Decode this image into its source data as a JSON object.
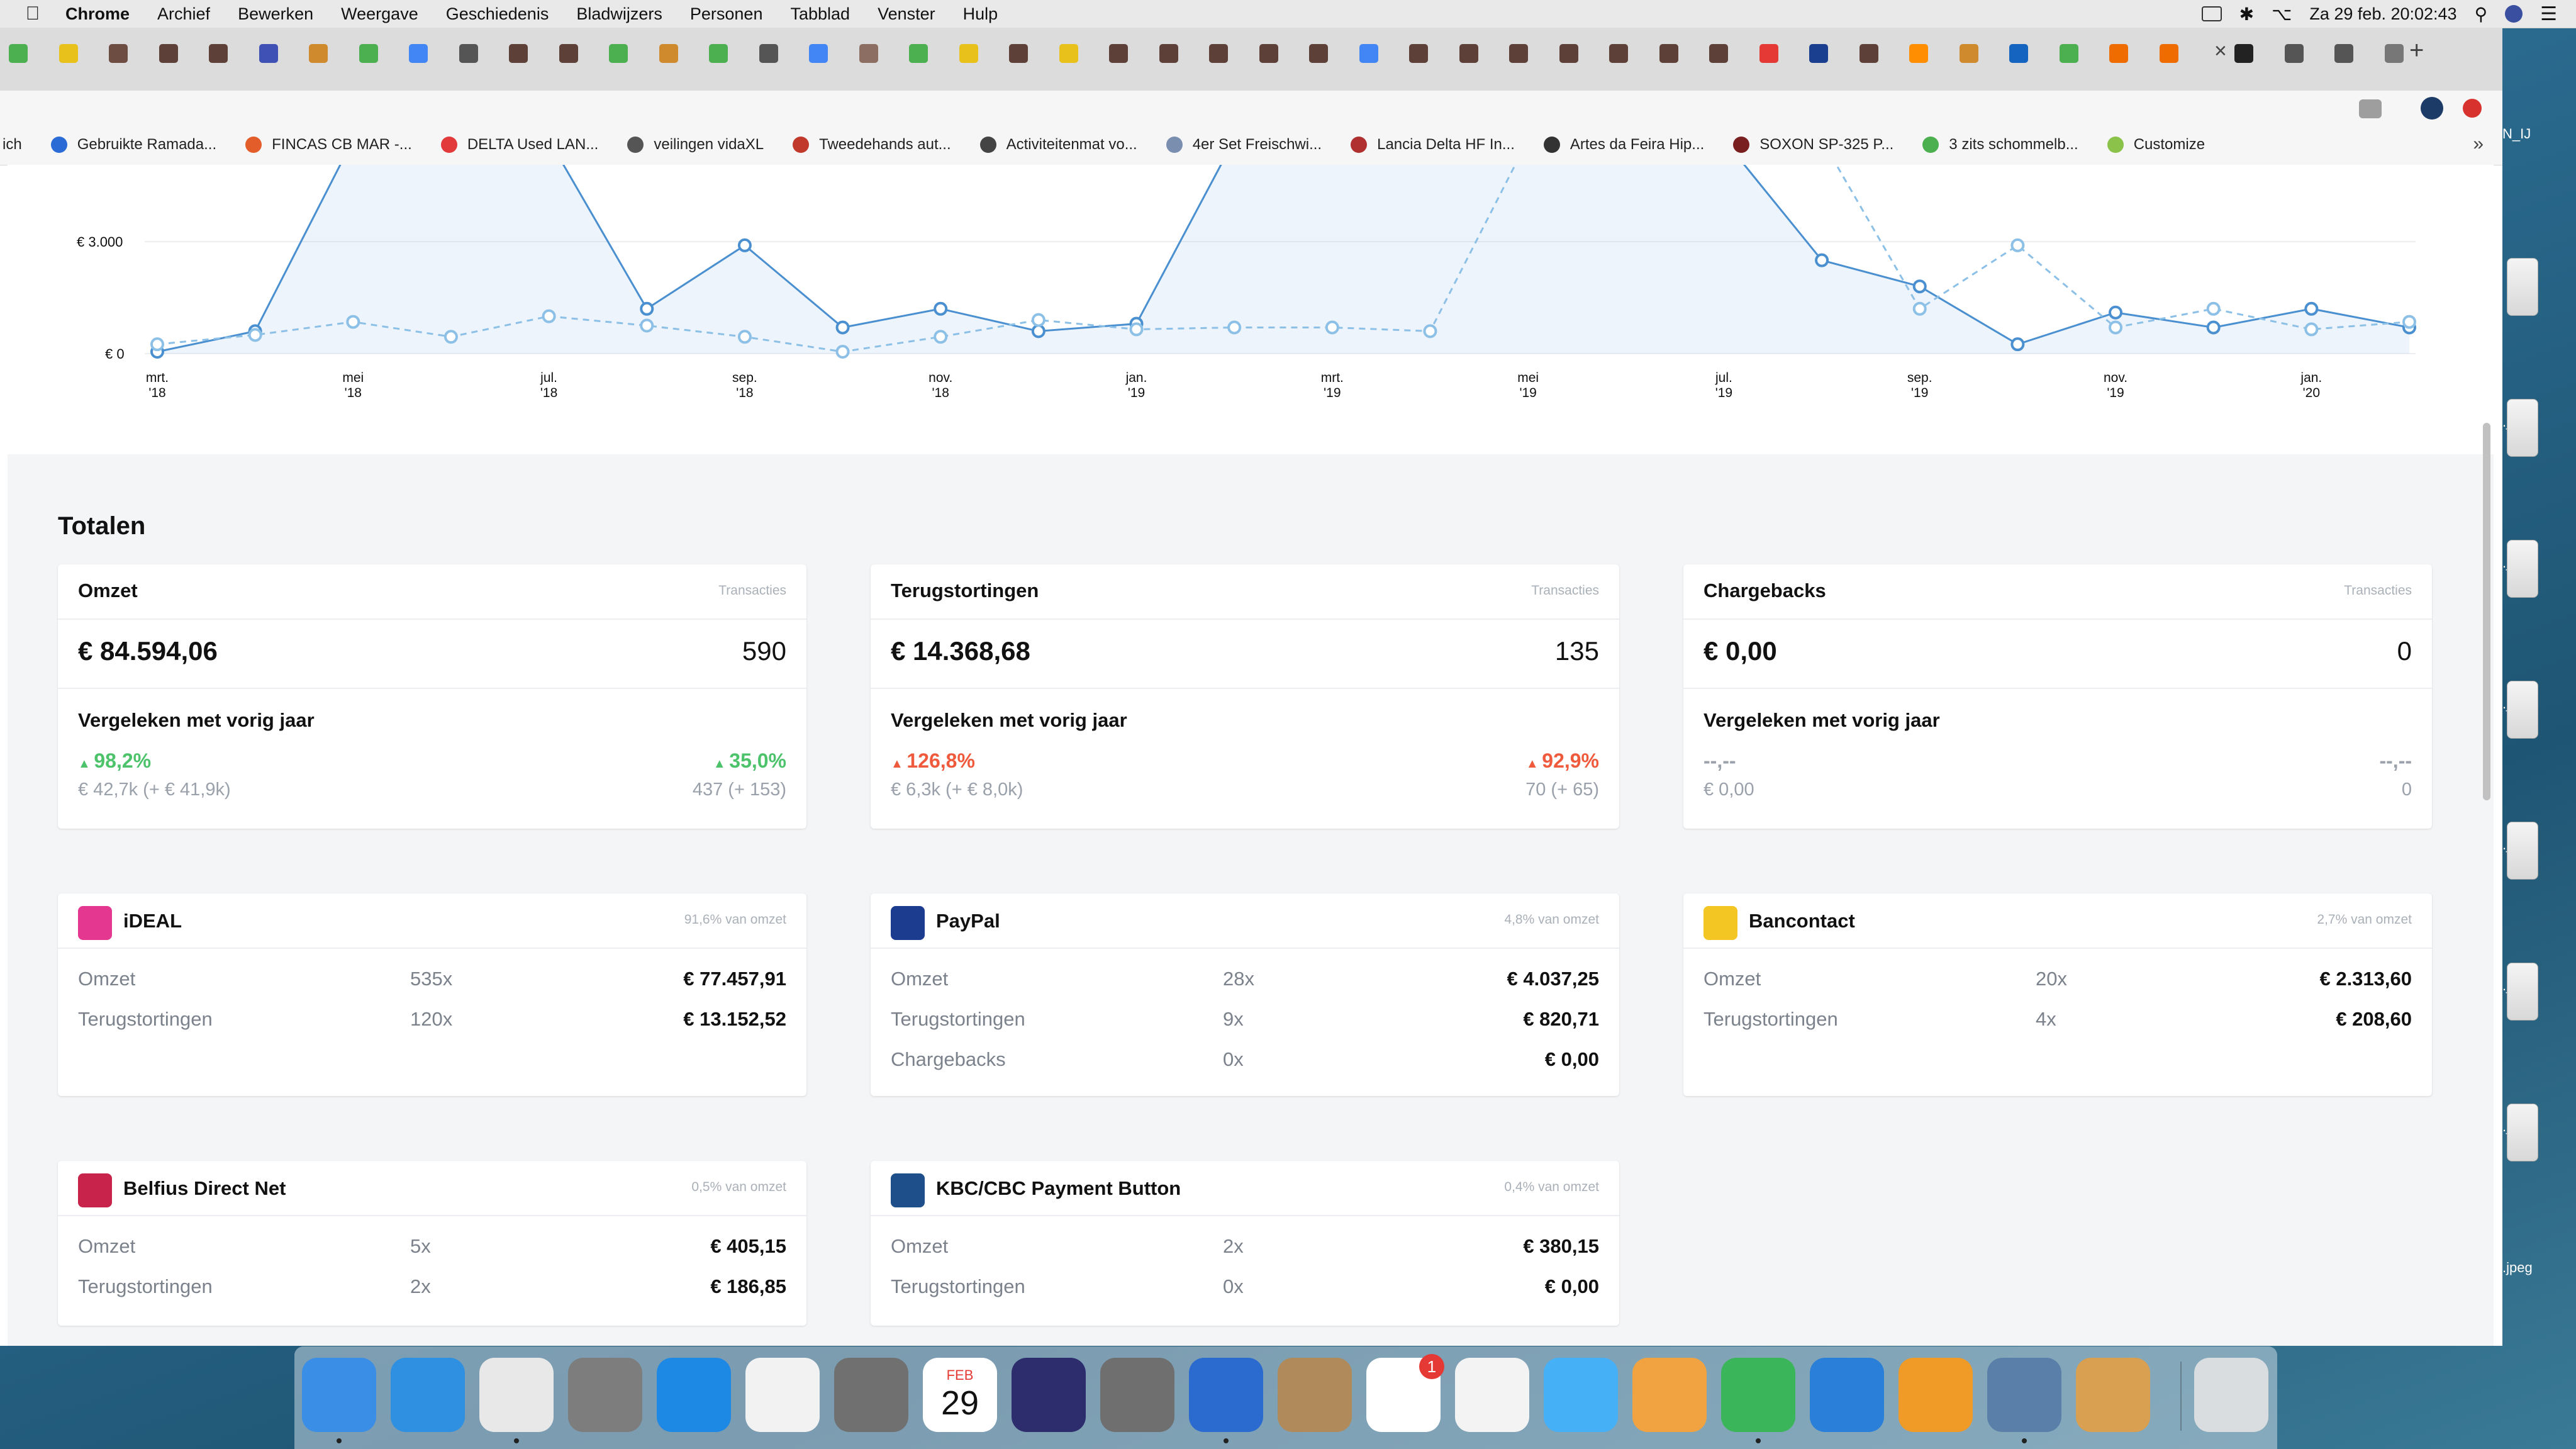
{
  "menubar": {
    "app": "Chrome",
    "items": [
      "Archief",
      "Bewerken",
      "Weergave",
      "Geschiedenis",
      "Bladwijzers",
      "Personen",
      "Tabblad",
      "Venster",
      "Hulp"
    ],
    "clock": "Za 29 feb.  20:02:43"
  },
  "bookmarks": [
    {
      "label": "ich",
      "color": "#e8b830"
    },
    {
      "label": "Gebruikte Ramada...",
      "color": "#2a6bd6"
    },
    {
      "label": "FINCAS CB MAR -...",
      "color": "#e35d2a"
    },
    {
      "label": "DELTA Used LAN...",
      "color": "#e23a3a"
    },
    {
      "label": "veilingen vidaXL",
      "color": "#555555"
    },
    {
      "label": "Tweedehands aut...",
      "color": "#c0392b"
    },
    {
      "label": "Activiteitenmat vo...",
      "color": "#444444"
    },
    {
      "label": "4er Set Freischwi...",
      "color": "#7a8fb0"
    },
    {
      "label": "Lancia Delta HF In...",
      "color": "#b03030"
    },
    {
      "label": "Artes da Feira Hip...",
      "color": "#333333"
    },
    {
      "label": "SOXON SP-325 P...",
      "color": "#7a1f1f"
    },
    {
      "label": "3 zits schommelb...",
      "color": "#4caf50"
    },
    {
      "label": "Customize",
      "color": "#8bc34a"
    }
  ],
  "bookmarks_more": "»",
  "chart_data": {
    "type": "line",
    "y_ticks": [
      "€ 0",
      "€ 3.000"
    ],
    "x_ticks": [
      {
        "m": "mrt.",
        "y": "'18"
      },
      {
        "m": "mei",
        "y": "'18"
      },
      {
        "m": "jul.",
        "y": "'18"
      },
      {
        "m": "sep.",
        "y": "'18"
      },
      {
        "m": "nov.",
        "y": "'18"
      },
      {
        "m": "jan.",
        "y": "'19"
      },
      {
        "m": "mrt.",
        "y": "'19"
      },
      {
        "m": "mei",
        "y": "'19"
      },
      {
        "m": "jul.",
        "y": "'19"
      },
      {
        "m": "sep.",
        "y": "'19"
      },
      {
        "m": "nov.",
        "y": "'19"
      },
      {
        "m": "jan.",
        "y": "'20"
      }
    ],
    "ylim": [
      0,
      4500
    ],
    "series": [
      {
        "style": "solid",
        "points": [
          [
            0,
            50
          ],
          [
            1,
            600
          ],
          [
            2,
            6000
          ],
          [
            3,
            6000
          ],
          [
            4,
            6000
          ],
          [
            5,
            1200
          ],
          [
            6,
            2900
          ],
          [
            7,
            700
          ],
          [
            8,
            1200
          ],
          [
            9,
            600
          ],
          [
            10,
            800
          ],
          [
            11,
            6000
          ],
          [
            12,
            6000
          ],
          [
            13,
            6000
          ],
          [
            14,
            6000
          ],
          [
            15,
            6000
          ],
          [
            16,
            6000
          ],
          [
            17,
            2500
          ],
          [
            18,
            1800
          ],
          [
            19,
            250
          ],
          [
            20,
            1100
          ],
          [
            21,
            700
          ],
          [
            22,
            1200
          ],
          [
            23,
            700
          ]
        ]
      },
      {
        "style": "dashed",
        "points": [
          [
            0,
            250
          ],
          [
            1,
            500
          ],
          [
            2,
            850
          ],
          [
            3,
            450
          ],
          [
            4,
            1000
          ],
          [
            5,
            750
          ],
          [
            6,
            450
          ],
          [
            7,
            50
          ],
          [
            8,
            450
          ],
          [
            9,
            900
          ],
          [
            10,
            650
          ],
          [
            11,
            700
          ],
          [
            12,
            700
          ],
          [
            13,
            600
          ],
          [
            14,
            6000
          ],
          [
            15,
            6000
          ],
          [
            16,
            6000
          ],
          [
            17,
            6000
          ],
          [
            18,
            1200
          ],
          [
            19,
            2900
          ],
          [
            20,
            700
          ],
          [
            21,
            1200
          ],
          [
            22,
            650
          ],
          [
            23,
            850
          ]
        ]
      }
    ]
  },
  "totals": {
    "title": "Totalen",
    "cards": [
      {
        "title": "Omzet",
        "sub": "Transacties",
        "amount": "€ 84.594,06",
        "count": "590",
        "compare": "Vergeleken met vorig jaar",
        "pct_left": "98,2%",
        "pct_right": "35,0%",
        "sub_left": "€ 42,7k (+ € 41,9k)",
        "sub_right": "437 (+ 153)",
        "trend": "up"
      },
      {
        "title": "Terugstortingen",
        "sub": "Transacties",
        "amount": "€ 14.368,68",
        "count": "135",
        "compare": "Vergeleken met vorig jaar",
        "pct_left": "126,8%",
        "pct_right": "92,9%",
        "sub_left": "€ 6,3k (+ € 8,0k)",
        "sub_right": "70 (+ 65)",
        "trend": "down"
      },
      {
        "title": "Chargebacks",
        "sub": "Transacties",
        "amount": "€ 0,00",
        "count": "0",
        "compare": "Vergeleken met vorig jaar",
        "pct_left": "--,--",
        "pct_right": "--,--",
        "sub_left": "€ 0,00",
        "sub_right": "0",
        "trend": "none"
      }
    ]
  },
  "methods": [
    {
      "title": "iDEAL",
      "share": "91,6% van omzet",
      "icon_color": "#e4378f",
      "rows": [
        {
          "label": "Omzet",
          "count": "535x",
          "amount": "€ 77.457,91"
        },
        {
          "label": "Terugstortingen",
          "count": "120x",
          "amount": "€ 13.152,52"
        }
      ]
    },
    {
      "title": "PayPal",
      "share": "4,8% van omzet",
      "icon_color": "#1b3c8f",
      "rows": [
        {
          "label": "Omzet",
          "count": "28x",
          "amount": "€ 4.037,25"
        },
        {
          "label": "Terugstortingen",
          "count": "9x",
          "amount": "€ 820,71"
        },
        {
          "label": "Chargebacks",
          "count": "0x",
          "amount": "€ 0,00"
        }
      ]
    },
    {
      "title": "Bancontact",
      "share": "2,7% van omzet",
      "icon_color": "#f3c623",
      "rows": [
        {
          "label": "Omzet",
          "count": "20x",
          "amount": "€ 2.313,60"
        },
        {
          "label": "Terugstortingen",
          "count": "4x",
          "amount": "€ 208,60"
        }
      ]
    },
    {
      "title": "Belfius Direct Net",
      "share": "0,5% van omzet",
      "icon_color": "#c8234a",
      "rows": [
        {
          "label": "Omzet",
          "count": "5x",
          "amount": "€ 405,15"
        },
        {
          "label": "Terugstortingen",
          "count": "2x",
          "amount": "€ 186,85"
        }
      ]
    },
    {
      "title": "KBC/CBC Payment Button",
      "share": "0,4% van omzet",
      "icon_color": "#1e4f8a",
      "rows": [
        {
          "label": "Omzet",
          "count": "2x",
          "amount": "€ 380,15"
        },
        {
          "label": "Terugstortingen",
          "count": "0x",
          "amount": "€ 0,00"
        }
      ]
    }
  ],
  "desktop_files": [
    ".jpeg",
    ".jpeg",
    ".jpeg",
    ".jpeg",
    ".jpeg",
    ".jpeg",
    ".jpeg"
  ],
  "desktop_top_label": "N_IJ",
  "dock": {
    "calendar_month": "FEB",
    "calendar_day": "29",
    "reminders_badge": "1"
  }
}
